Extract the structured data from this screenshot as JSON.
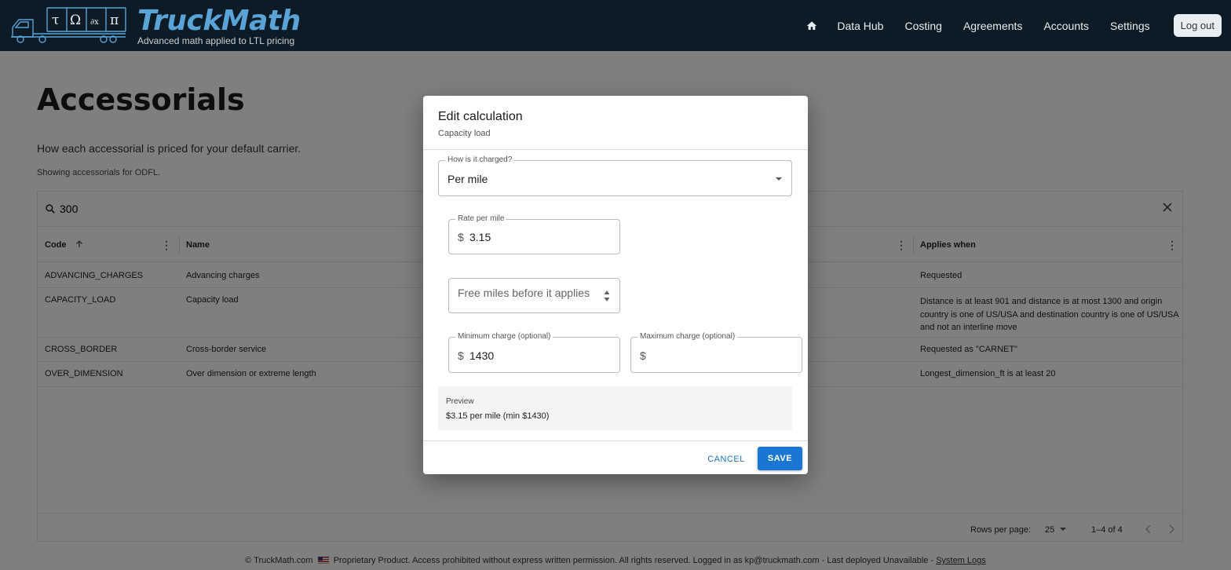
{
  "header": {
    "brand_name": "TruckMath",
    "brand_tagline": "Advanced math applied to LTL pricing",
    "logo_symbols": [
      "τ",
      "Ω",
      "∂x",
      "π"
    ],
    "nav": [
      "Data Hub",
      "Costing",
      "Agreements",
      "Accounts",
      "Settings"
    ],
    "logout_label": "Log out"
  },
  "page": {
    "title": "Accessorials",
    "description": "How each accessorial is priced for your default carrier.",
    "showing": "Showing accessorials for ODFL."
  },
  "grid": {
    "search_value": "300",
    "columns": {
      "code": "Code",
      "name": "Name",
      "applies": "Applies when"
    },
    "rows": [
      {
        "code": "ADVANCING_CHARGES",
        "name": "Advancing charges",
        "applies": "Requested"
      },
      {
        "code": "CAPACITY_LOAD",
        "name": "Capacity load",
        "applies": "Distance is at least 901 and distance is at most 1300 and origin country is one of US/USA and destination country is one of US/USA and not an interline move"
      },
      {
        "code": "CROSS_BORDER",
        "name": "Cross-border service",
        "applies": "Requested as \"CARNET\""
      },
      {
        "code": "OVER_DIMENSION",
        "name": "Over dimension or extreme length",
        "applies": "Longest_dimension_ft is at least 20"
      }
    ],
    "rows_per_page_label": "Rows per page:",
    "rows_per_page_value": "25",
    "pagination": "1–4 of 4"
  },
  "footer": {
    "copyright": "© TruckMath.com",
    "notice": "Proprietary Product. Access prohibited without express written permission. All rights reserved. Logged in as kp@truckmath.com - Last deployed Unavailable -",
    "system_logs": "System Logs"
  },
  "dialog": {
    "title": "Edit calculation",
    "subtitle": "Capacity load",
    "charge_label": "How is it charged?",
    "charge_value": "Per mile",
    "rate_label": "Rate per mile",
    "currency": "$",
    "rate_value": "3.15",
    "free_miles_placeholder": "Free miles before it applies",
    "min_label": "Minimum charge (optional)",
    "min_value": "1430",
    "max_label": "Maximum charge (optional)",
    "max_value": "",
    "preview_label": "Preview",
    "preview_text": "$3.15 per mile (min $1430)",
    "cancel_label": "CANCEL",
    "save_label": "SAVE"
  },
  "colors": {
    "header_bg": "#0d1b26",
    "brand": "#5aa3d6",
    "primary": "#1976d2"
  }
}
